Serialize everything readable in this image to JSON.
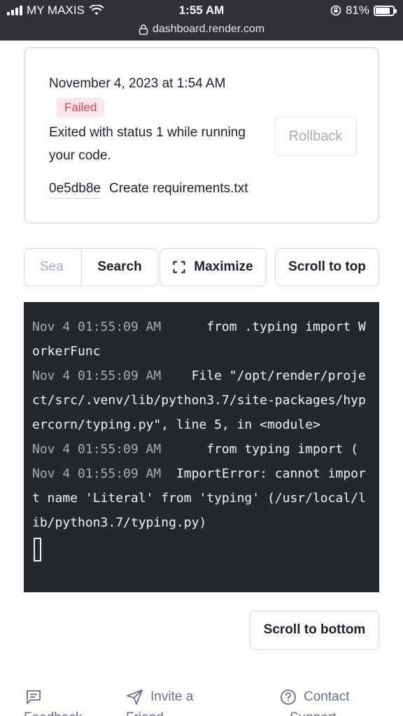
{
  "status_bar": {
    "carrier": "MY MAXIS",
    "time": "1:55 AM",
    "battery": "81%",
    "url": "dashboard.render.com"
  },
  "deploy": {
    "date": "November 4, 2023 at 1:54 AM",
    "status": "Failed",
    "message": "Exited with status 1 while running your code.",
    "rollback_label": "Rollback",
    "commit_hash": "0e5db8e",
    "commit_message": "Create requirements.txt"
  },
  "toolbar": {
    "search_placeholder": "Sea",
    "search_label": "Search",
    "maximize_label": "Maximize",
    "scroll_top_label": "Scroll to top"
  },
  "logs": [
    {
      "ts": "Nov 4 01:55:09 AM",
      "text": "      from .typing import WorkerFunc"
    },
    {
      "ts": "Nov 4 01:55:09 AM",
      "text": "    File \"/opt/render/project/src/.venv/lib/python3.7/site-packages/hypercorn/typing.py\", line 5, in <module>"
    },
    {
      "ts": "Nov 4 01:55:09 AM",
      "text": "      from typing import ("
    },
    {
      "ts": "Nov 4 01:55:09 AM",
      "text": "  ImportError: cannot import name 'Literal' from 'typing' (/usr/local/lib/python3.7/typing.py)"
    }
  ],
  "scroll_bottom_label": "Scroll to bottom",
  "footer": {
    "feedback_label": "Feedback",
    "invite_label": "Invite a",
    "invite_label_2": "Friend",
    "contact_label": "Contact",
    "contact_label_2": "Support"
  },
  "colors": {
    "terminal_bg": "#242630",
    "failed_badge_bg": "#fde5ea",
    "failed_badge_text": "#d8435f",
    "status_bar_bg": "#2f3038"
  }
}
